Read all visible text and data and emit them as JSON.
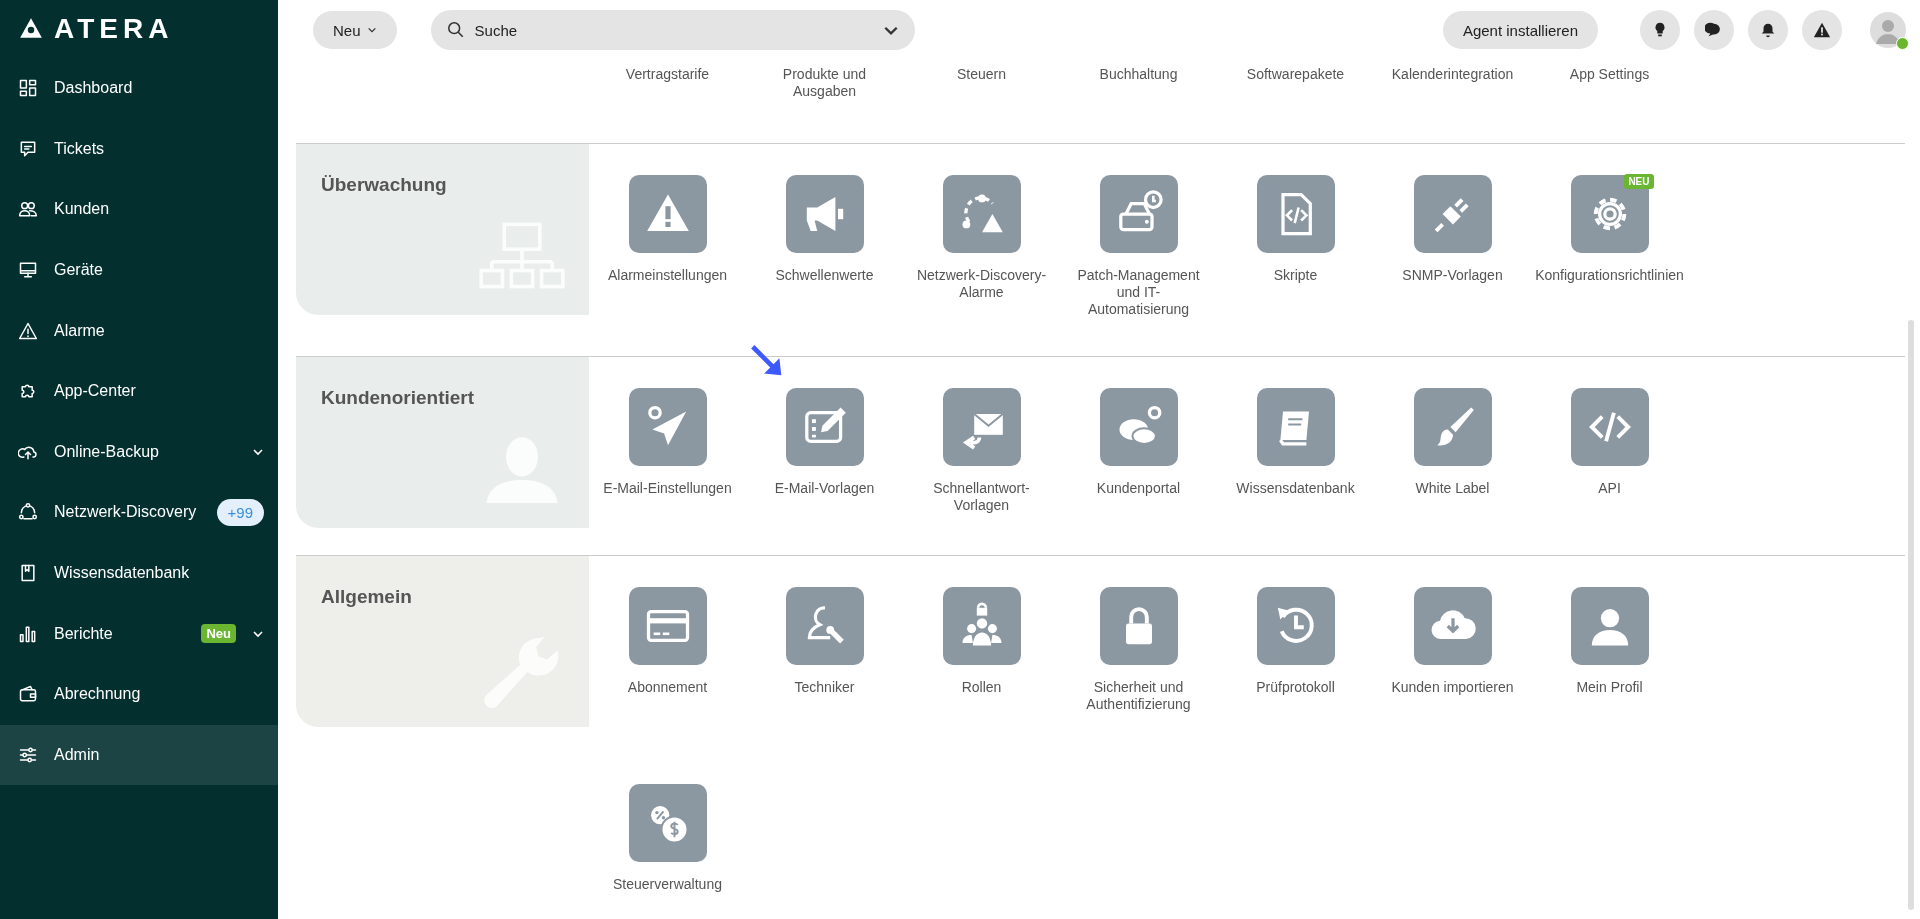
{
  "sidebar": {
    "logo": "ATERA",
    "items": [
      {
        "kind": "dashboard",
        "label": "Dashboard",
        "selected": false,
        "submenu": false
      },
      {
        "kind": "ticket",
        "label": "Tickets",
        "selected": false,
        "submenu": false
      },
      {
        "kind": "users",
        "label": "Kunden",
        "selected": false,
        "submenu": false
      },
      {
        "kind": "monitor",
        "label": "Geräte",
        "selected": false,
        "submenu": false
      },
      {
        "kind": "alert",
        "label": "Alarme",
        "selected": false,
        "submenu": false
      },
      {
        "kind": "puzzle",
        "label": "App-Center",
        "selected": false,
        "submenu": false
      },
      {
        "kind": "cloud",
        "label": "Online-Backup",
        "selected": false,
        "submenu": true
      },
      {
        "kind": "network",
        "label": "Netzwerk-Discovery",
        "selected": false,
        "submenu": false,
        "badge": {
          "kind": "count",
          "text": "+99"
        }
      },
      {
        "kind": "book",
        "label": "Wissensdatenbank",
        "selected": false,
        "submenu": false
      },
      {
        "kind": "chart",
        "label": "Berichte",
        "selected": false,
        "submenu": true,
        "badge": {
          "kind": "new",
          "text": "Neu"
        }
      },
      {
        "kind": "wallet",
        "label": "Abrechnung",
        "selected": false,
        "submenu": false
      },
      {
        "kind": "sliders",
        "label": "Admin",
        "selected": true,
        "submenu": false
      }
    ]
  },
  "topbar": {
    "new_button": "Neu",
    "search": {
      "placeholder": "Suche"
    },
    "agent_button": "Agent installieren",
    "user": {
      "online": true
    }
  },
  "top_row": [
    "Vertragstarife",
    "Produkte und Ausgaben",
    "Steuern",
    "Buchhaltung",
    "Softwarepakete",
    "Kalenderintegration",
    "App Settings"
  ],
  "sections": [
    {
      "title": "Überwachung",
      "kind": "monitoring",
      "tiles": [
        {
          "kind": "warning",
          "label": "Alarmeinstellungen"
        },
        {
          "kind": "megaphone",
          "label": "Schwellenwerte"
        },
        {
          "kind": "discovery",
          "label": "Netzwerk-Discovery-Alarme"
        },
        {
          "kind": "patch",
          "label": "Patch-Management und IT-Automatisierung"
        },
        {
          "kind": "script",
          "label": "Skripte"
        },
        {
          "kind": "plug",
          "label": "SNMP-Vorlagen"
        },
        {
          "kind": "gear",
          "label": "Konfigurationsrichtlinien",
          "badge": "NEU"
        }
      ]
    },
    {
      "title": "Kundenorientiert",
      "kind": "customer",
      "tiles": [
        {
          "kind": "send",
          "label": "E-Mail-Einstellungen"
        },
        {
          "kind": "edit",
          "label": "E-Mail-Vorlagen"
        },
        {
          "kind": "reply",
          "label": "Schnellantwort-Vorlagen"
        },
        {
          "kind": "chat",
          "label": "Kundenportal"
        },
        {
          "kind": "book",
          "label": "Wissensdatenbank"
        },
        {
          "kind": "brush",
          "label": "White Label"
        },
        {
          "kind": "code",
          "label": "API"
        }
      ]
    },
    {
      "title": "Allgemein",
      "kind": "general",
      "tiles": [
        {
          "kind": "card",
          "label": "Abonnement"
        },
        {
          "kind": "tech",
          "label": "Techniker"
        },
        {
          "kind": "roles",
          "label": "Rollen"
        },
        {
          "kind": "lock",
          "label": "Sicherheit und Authentifizierung"
        },
        {
          "kind": "history",
          "label": "Prüfprotokoll"
        },
        {
          "kind": "download",
          "label": "Kunden importieren"
        },
        {
          "kind": "profile",
          "label": "Mein Profil"
        }
      ]
    }
  ],
  "extra_tiles": [
    {
      "kind": "tax",
      "label": "Steuerverwaltung"
    }
  ]
}
